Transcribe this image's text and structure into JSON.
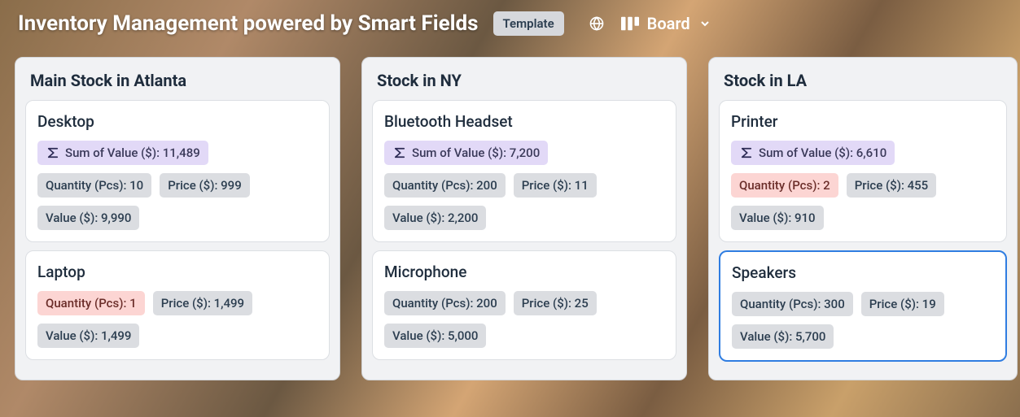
{
  "header": {
    "title": "Inventory Management powered by Smart Fields",
    "template_badge": "Template",
    "view_label": "Board"
  },
  "labels": {
    "sum_prefix": "Sum of Value ($): ",
    "qty_prefix": "Quantity (Pcs): ",
    "price_prefix": "Price ($): ",
    "value_prefix": "Value ($): "
  },
  "columns": [
    {
      "title": "Main Stock in Atlanta",
      "cards": [
        {
          "title": "Desktop",
          "sum": "11,489",
          "qty": "10",
          "qty_warn": false,
          "price": "999",
          "value": "9,990",
          "selected": false
        },
        {
          "title": "Laptop",
          "sum": null,
          "qty": "1",
          "qty_warn": true,
          "price": "1,499",
          "value": "1,499",
          "selected": false
        }
      ]
    },
    {
      "title": "Stock in NY",
      "cards": [
        {
          "title": "Bluetooth Headset",
          "sum": "7,200",
          "qty": "200",
          "qty_warn": false,
          "price": "11",
          "value": "2,200",
          "selected": false
        },
        {
          "title": "Microphone",
          "sum": null,
          "qty": "200",
          "qty_warn": false,
          "price": "25",
          "value": "5,000",
          "selected": false
        }
      ]
    },
    {
      "title": "Stock in LA",
      "cards": [
        {
          "title": "Printer",
          "sum": "6,610",
          "qty": "2",
          "qty_warn": true,
          "price": "455",
          "value": "910",
          "selected": false
        },
        {
          "title": "Speakers",
          "sum": null,
          "qty": "300",
          "qty_warn": false,
          "price": "19",
          "value": "5,700",
          "selected": true
        }
      ]
    }
  ]
}
